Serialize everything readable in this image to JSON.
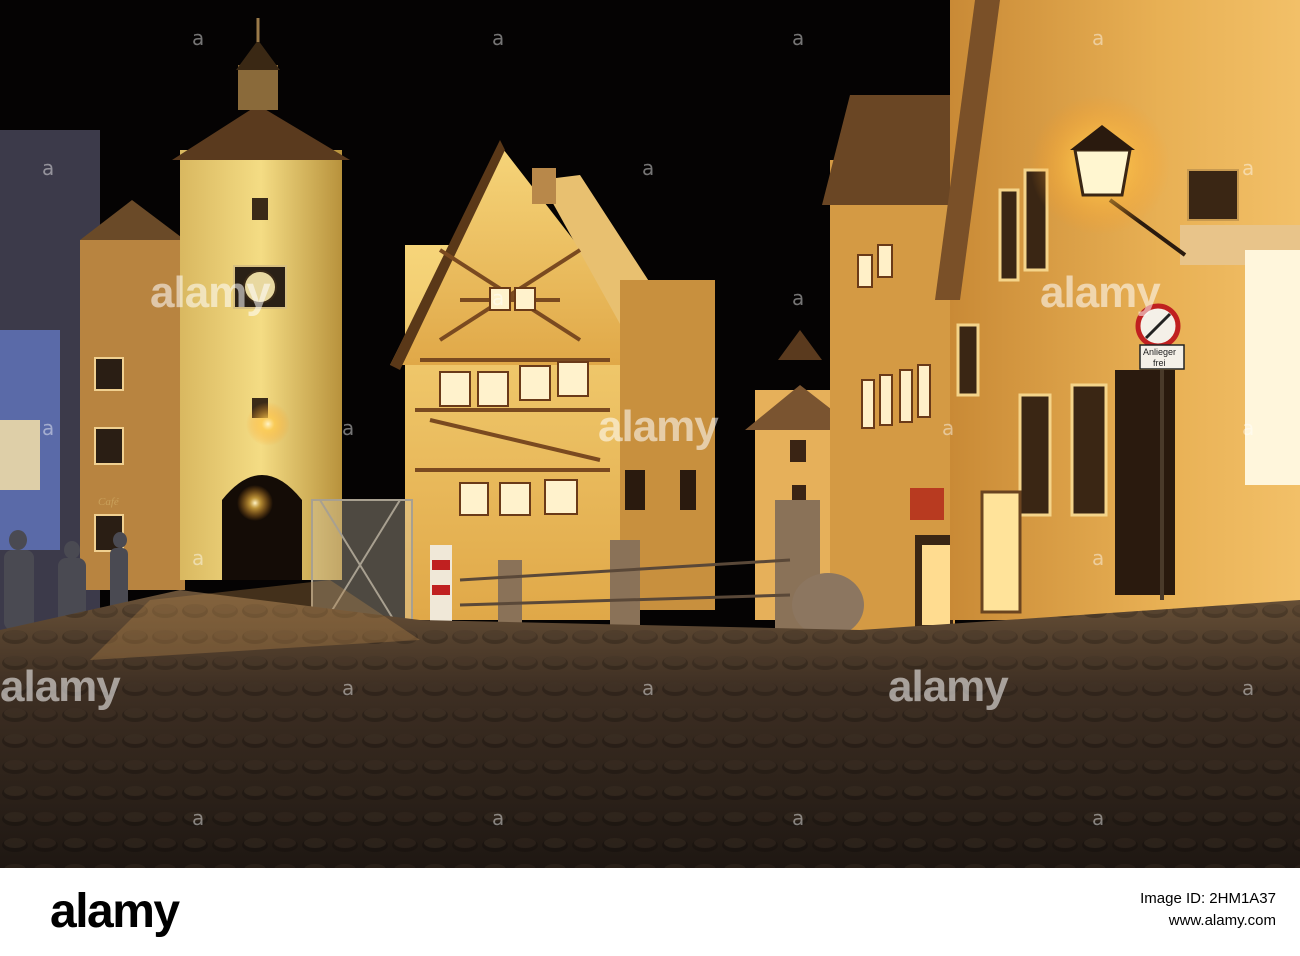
{
  "photo": {
    "subject": "night-street-scene",
    "street_sign": {
      "line1": "Anlieger",
      "line2": "frei"
    },
    "cafe_sign": "Café",
    "colors": {
      "sky": "#050303",
      "lamp": "#ffcf5a",
      "facade": "#e9b54e",
      "cobble": "#3a2c22"
    }
  },
  "watermark": {
    "text": "alamy",
    "glyph": "a"
  },
  "footer": {
    "logo": "alamy",
    "image_id_label": "Image ID: 2HM1A37",
    "url": "www.alamy.com"
  }
}
